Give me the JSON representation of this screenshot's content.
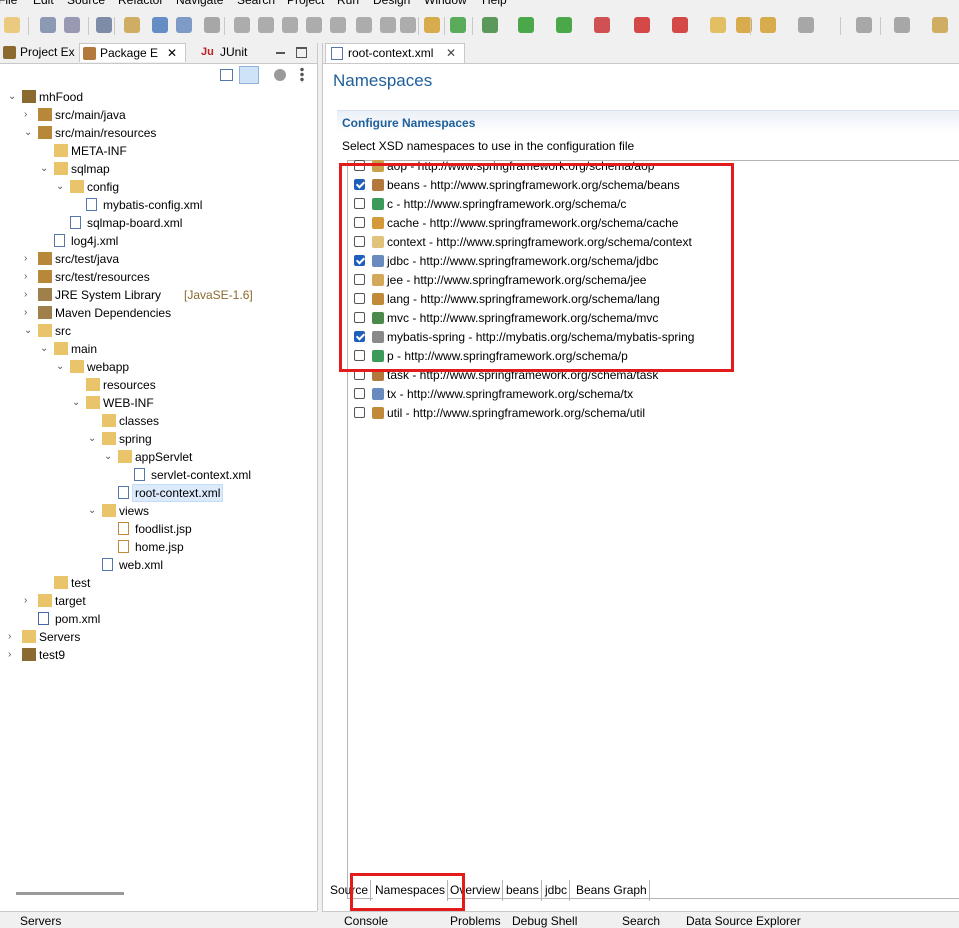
{
  "menu": [
    "File",
    "Edit",
    "Source",
    "Refactor",
    "Navigate",
    "Search",
    "Project",
    "Run",
    "Design",
    "Window",
    "Help"
  ],
  "left_tabs": [
    {
      "label": "Project Ex",
      "icon": "project-explorer-icon"
    },
    {
      "label": "Package E",
      "icon": "package-explorer-icon",
      "close": "✕"
    },
    {
      "label": "JUnit",
      "icon": "junit-icon",
      "prefix": "Ju"
    }
  ],
  "tree": [
    {
      "label": "mhFood",
      "icon": "maven-project-icon",
      "arrow": "⌄",
      "extra": ""
    },
    {
      "label": "src/main/java",
      "icon": "source-folder-icon",
      "arrow": "›",
      "extra": ""
    },
    {
      "label": "src/main/resources",
      "icon": "source-folder-icon",
      "arrow": "⌄",
      "extra": ""
    },
    {
      "label": "META-INF",
      "icon": "folder-icon",
      "arrow": "",
      "extra": ""
    },
    {
      "label": "sqlmap",
      "icon": "folder-icon",
      "arrow": "⌄",
      "extra": ""
    },
    {
      "label": "config",
      "icon": "folder-icon",
      "arrow": "⌄",
      "extra": ""
    },
    {
      "label": "mybatis-config.xml",
      "icon": "xml-file-icon",
      "arrow": "",
      "extra": ""
    },
    {
      "label": "sqlmap-board.xml",
      "icon": "xml-file-icon",
      "arrow": "",
      "extra": ""
    },
    {
      "label": "log4j.xml",
      "icon": "xml-file-icon",
      "arrow": "",
      "extra": ""
    },
    {
      "label": "src/test/java",
      "icon": "source-folder-icon",
      "arrow": "›",
      "extra": ""
    },
    {
      "label": "src/test/resources",
      "icon": "source-folder-icon",
      "arrow": "›",
      "extra": ""
    },
    {
      "label": "JRE System Library",
      "icon": "library-icon",
      "arrow": "›",
      "extra": "[JavaSE-1.6]"
    },
    {
      "label": "Maven Dependencies",
      "icon": "library-icon",
      "arrow": "›",
      "extra": ""
    },
    {
      "label": "src",
      "icon": "spring-folder-icon",
      "arrow": "⌄",
      "extra": ""
    },
    {
      "label": "main",
      "icon": "spring-folder-icon",
      "arrow": "⌄",
      "extra": ""
    },
    {
      "label": "webapp",
      "icon": "spring-folder-icon",
      "arrow": "⌄",
      "extra": ""
    },
    {
      "label": "resources",
      "icon": "folder-icon",
      "arrow": "",
      "extra": ""
    },
    {
      "label": "WEB-INF",
      "icon": "folder-icon",
      "arrow": "⌄",
      "extra": ""
    },
    {
      "label": "classes",
      "icon": "folder-icon",
      "arrow": "",
      "extra": ""
    },
    {
      "label": "spring",
      "icon": "spring-folder-icon",
      "arrow": "⌄",
      "extra": ""
    },
    {
      "label": "appServlet",
      "icon": "spring-folder-icon",
      "arrow": "⌄",
      "extra": ""
    },
    {
      "label": "servlet-context.xml",
      "icon": "spring-xml-icon",
      "arrow": "",
      "extra": ""
    },
    {
      "label": "root-context.xml",
      "icon": "spring-xml-icon",
      "arrow": "",
      "extra": ""
    },
    {
      "label": "views",
      "icon": "folder-icon",
      "arrow": "⌄",
      "extra": ""
    },
    {
      "label": "foodlist.jsp",
      "icon": "jsp-file-icon",
      "arrow": "",
      "extra": ""
    },
    {
      "label": "home.jsp",
      "icon": "jsp-file-icon",
      "arrow": "",
      "extra": ""
    },
    {
      "label": "web.xml",
      "icon": "xml-file-icon",
      "arrow": "",
      "extra": ""
    },
    {
      "label": "test",
      "icon": "folder-icon",
      "arrow": "",
      "extra": ""
    },
    {
      "label": "target",
      "icon": "folder-icon",
      "arrow": "›",
      "extra": ""
    },
    {
      "label": "pom.xml",
      "icon": "pom-file-icon",
      "arrow": "",
      "extra": ""
    },
    {
      "label": "Servers",
      "icon": "folder-icon",
      "arrow": "›",
      "extra": ""
    },
    {
      "label": "test9",
      "icon": "maven-project-error-icon",
      "arrow": "›",
      "extra": ""
    }
  ],
  "editor": {
    "tab_label": "root-context.xml",
    "tab_close": "✕",
    "heading": "Namespaces",
    "section_title": "Configure Namespaces",
    "section_desc": "Select XSD namespaces to use in the configuration file"
  },
  "namespaces": [
    {
      "label": "aop - http://www.springframework.org/schema/aop",
      "checked": false,
      "icon": "aop-icon",
      "color": "#c9a14a"
    },
    {
      "label": "beans - http://www.springframework.org/schema/beans",
      "checked": true,
      "icon": "beans-icon",
      "color": "#b3783c"
    },
    {
      "label": "c - http://www.springframework.org/schema/c",
      "checked": false,
      "icon": "c-namespace-icon",
      "color": "#3d9b5a"
    },
    {
      "label": "cache - http://www.springframework.org/schema/cache",
      "checked": false,
      "icon": "cache-icon",
      "color": "#d49a3a"
    },
    {
      "label": "context - http://www.springframework.org/schema/context",
      "checked": false,
      "icon": "context-icon",
      "color": "#e0c27a"
    },
    {
      "label": "jdbc - http://www.springframework.org/schema/jdbc",
      "checked": true,
      "icon": "jdbc-icon",
      "color": "#6a8bc0"
    },
    {
      "label": "jee - http://www.springframework.org/schema/jee",
      "checked": false,
      "icon": "jee-icon",
      "color": "#d4a85a"
    },
    {
      "label": "lang - http://www.springframework.org/schema/lang",
      "checked": false,
      "icon": "lang-icon",
      "color": "#c08a3a"
    },
    {
      "label": "mvc - http://www.springframework.org/schema/mvc",
      "checked": false,
      "icon": "mvc-icon",
      "color": "#4b8a4b"
    },
    {
      "label": "mybatis-spring - http://mybatis.org/schema/mybatis-spring",
      "checked": true,
      "icon": "mybatis-icon",
      "color": "#8a8a8a"
    },
    {
      "label": "p - http://www.springframework.org/schema/p",
      "checked": false,
      "icon": "p-namespace-icon",
      "color": "#3d9b5a"
    },
    {
      "label": "task - http://www.springframework.org/schema/task",
      "checked": false,
      "icon": "task-icon",
      "color": "#b3783c"
    },
    {
      "label": "tx - http://www.springframework.org/schema/tx",
      "checked": false,
      "icon": "tx-icon",
      "color": "#6a8bc0"
    },
    {
      "label": "util - http://www.springframework.org/schema/util",
      "checked": false,
      "icon": "util-icon",
      "color": "#c08a3a"
    }
  ],
  "page_tabs": [
    "Source",
    "Namespaces",
    "Overview",
    "beans",
    "jdbc",
    "Beans Graph"
  ],
  "bottom_left_tabs": [
    "Servers"
  ],
  "bottom_right_tabs": [
    "Console",
    "Problems",
    "Debug Shell",
    "Search",
    "Data Source Explorer"
  ],
  "accent_colors": {
    "heading": "#1f5f9a",
    "highlight": "#e41b1b",
    "checkbox": "#1e5fbd"
  }
}
